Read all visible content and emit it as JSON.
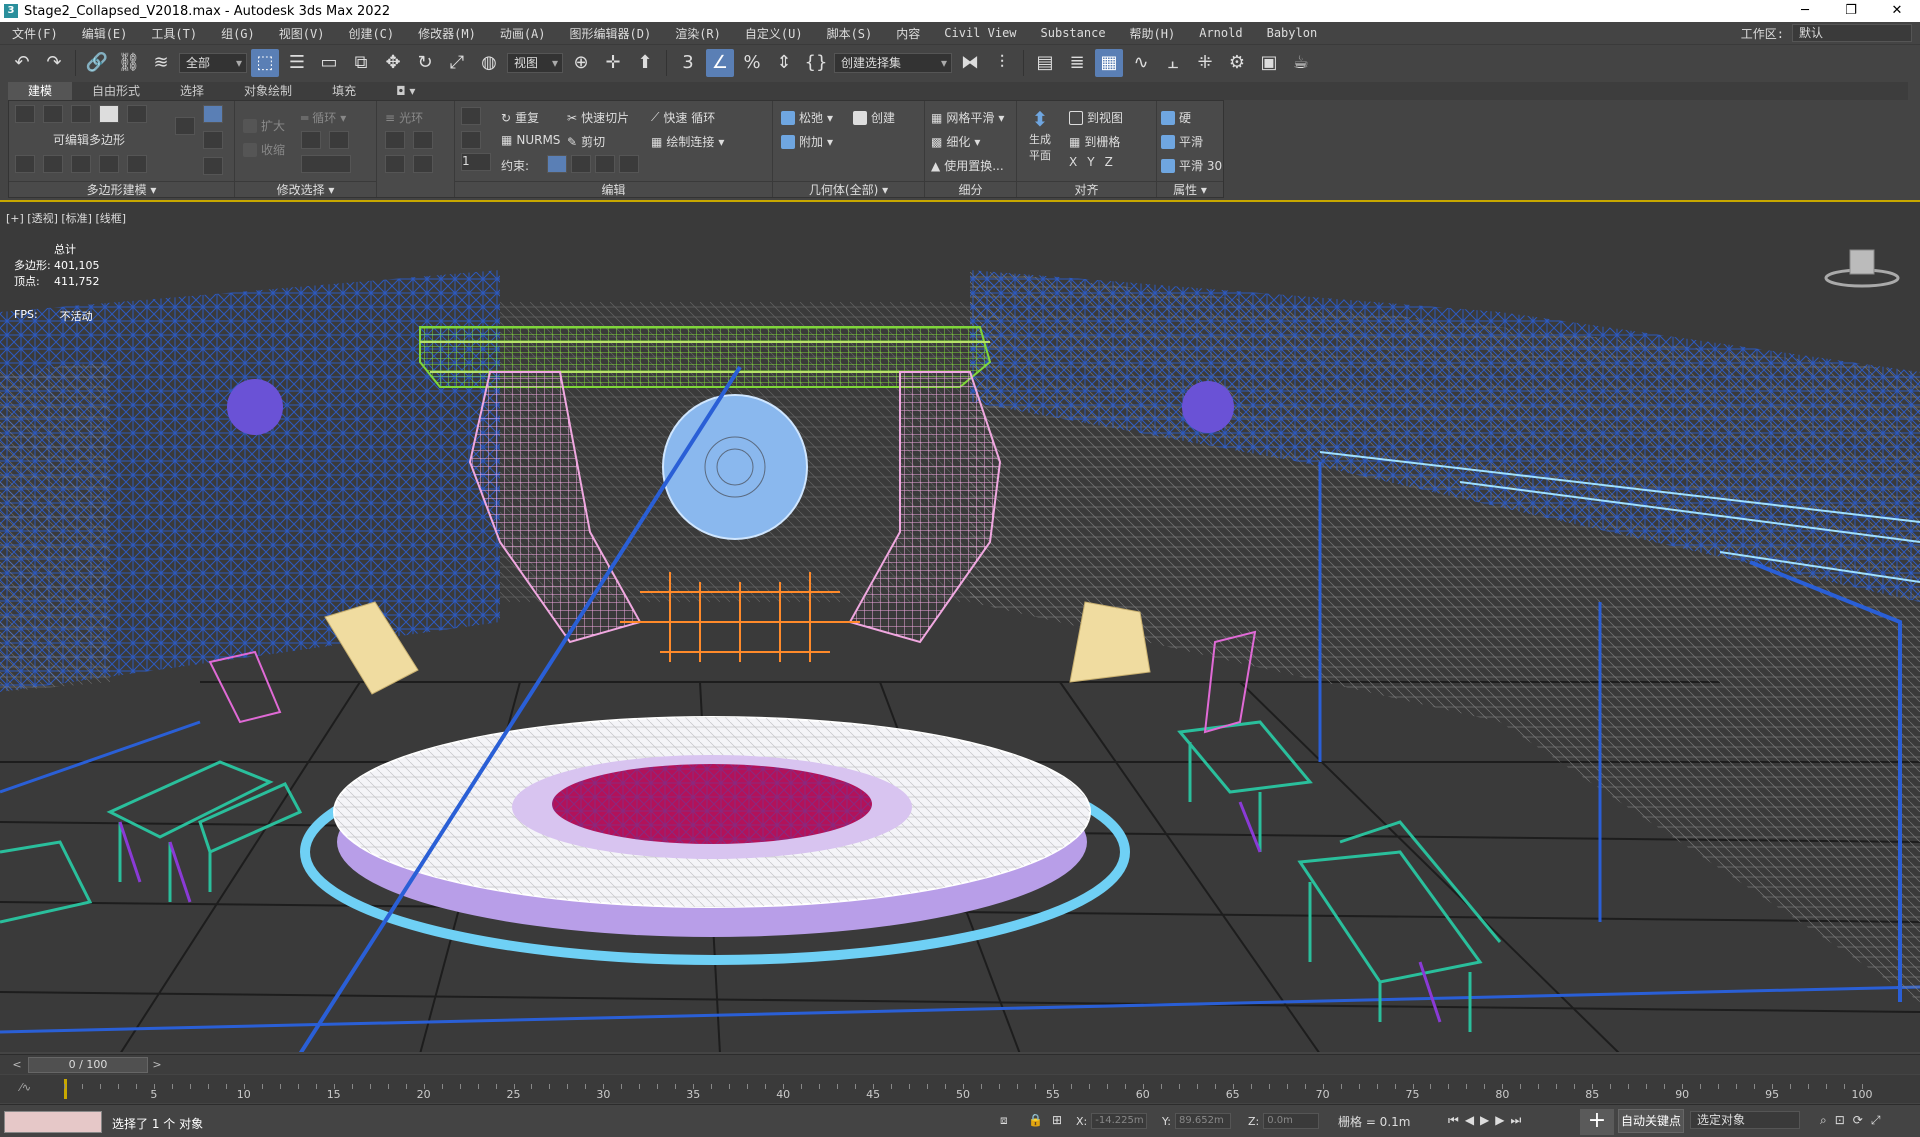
{
  "window": {
    "title": "Stage2_Collapsed_V2018.max - Autodesk 3ds Max 2022",
    "min": "─",
    "max": "❐",
    "close": "✕"
  },
  "menu": {
    "items": [
      "文件(F)",
      "编辑(E)",
      "工具(T)",
      "组(G)",
      "视图(V)",
      "创建(C)",
      "修改器(M)",
      "动画(A)",
      "图形编辑器(D)",
      "渲染(R)",
      "自定义(U)",
      "脚本(S)",
      "内容",
      "Civil View",
      "Substance",
      "帮助(H)",
      "Arnold",
      "Babylon"
    ],
    "workspace_label": "工作区:",
    "workspace_value": "默认"
  },
  "toolbar": {
    "filter_select": "全部",
    "ref_coord": "视图",
    "named_selection": "创建选择集"
  },
  "ribbon": {
    "tabs": [
      "建模",
      "自由形式",
      "选择",
      "对象绘制",
      "填充"
    ],
    "active_tab": "建模",
    "panels": {
      "poly_modeling": {
        "title": "多边形建模",
        "editable_poly": "可编辑多边形"
      },
      "modify_selection": {
        "title": "修改选择",
        "grow": "扩大",
        "shrink": "收缩",
        "loop": "循环",
        "ring": "光环"
      },
      "edit": {
        "title": "编辑",
        "repeat": "重复",
        "quickslice": "快速切片",
        "swiftloop": "快速 循环",
        "nurms": "NURMS",
        "cut": "剪切",
        "paintconnect": "绘制连接",
        "constraints": "约束:",
        "spinner_value": "1"
      },
      "geometry": {
        "title": "几何体(全部)",
        "relax": "松弛",
        "create": "创建",
        "attach": "附加"
      },
      "subdivision": {
        "title": "细分",
        "meshsmooth": "网格平滑",
        "tessellate": "细化",
        "usedisplace": "使用置换..."
      },
      "align": {
        "title": "对齐",
        "makeplanar": "生成 平面",
        "toview": "到视图",
        "togrid": "到栅格",
        "x": "X",
        "y": "Y",
        "z": "Z"
      },
      "properties": {
        "title": "属性",
        "hard": "硬",
        "smooth": "平滑",
        "smooth30": "平滑 30"
      }
    }
  },
  "viewport": {
    "label": "[+] [透视] [标准] [线框]",
    "stats_header": "总计",
    "polys_label": "多边形:",
    "polys_value": "401,105",
    "verts_label": "顶点:",
    "verts_value": "411,752",
    "fps_label": "FPS:",
    "fps_value": "不活动"
  },
  "timeslider": {
    "position": "0 / 100",
    "prev": "<",
    "next": ">"
  },
  "trackbar": {
    "ticks": [
      "5",
      "10",
      "15",
      "20",
      "25",
      "30",
      "35",
      "40",
      "45",
      "50",
      "55",
      "60",
      "65",
      "70",
      "75",
      "80",
      "85",
      "90",
      "95",
      "100"
    ]
  },
  "status": {
    "selection_text": "选择了 1 个 对象",
    "x_label": "X:",
    "x_value": "-14.225m",
    "y_label": "Y:",
    "y_value": "89.652m",
    "z_label": "Z:",
    "z_value": "0.0m",
    "grid_text": "栅格 = 0.1m",
    "autokey": "自动关键点",
    "selected_objects": "选定对象"
  },
  "colors": {
    "accent": "#5a7fb5",
    "viewport_border": "#c8a800",
    "wire_blue": "#2a5fd6",
    "wire_pink": "#e89ad6",
    "wire_green": "#7fd63a"
  }
}
